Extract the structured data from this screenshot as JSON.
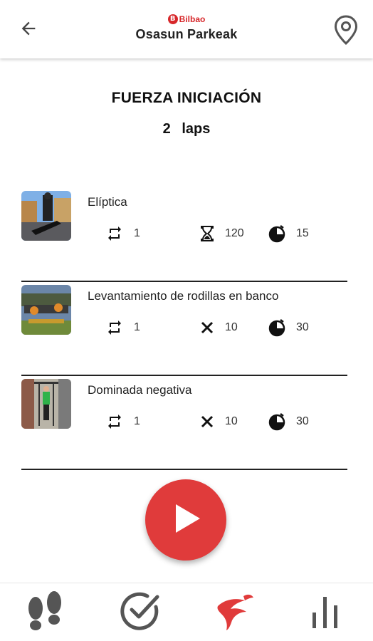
{
  "header": {
    "logo_text": "Bilbao",
    "logo_letter": "B",
    "title": "Osasun Parkeak",
    "back_icon": "arrow-left-icon",
    "location_icon": "location-pin-icon"
  },
  "routine": {
    "title": "FUERZA INICIACIÓN",
    "laps_count": "2",
    "laps_label": "laps"
  },
  "exercises": [
    {
      "name": "Elíptica",
      "stats": [
        {
          "icon": "repeat-icon",
          "value": "1"
        },
        {
          "icon": "hourglass-icon",
          "value": "120"
        },
        {
          "icon": "timer-icon",
          "value": "15"
        }
      ]
    },
    {
      "name": "Levantamiento de rodillas en banco",
      "stats": [
        {
          "icon": "repeat-icon",
          "value": "1"
        },
        {
          "icon": "times-icon",
          "value": "10"
        },
        {
          "icon": "timer-icon",
          "value": "30"
        }
      ]
    },
    {
      "name": "Dominada negativa",
      "stats": [
        {
          "icon": "repeat-icon",
          "value": "1"
        },
        {
          "icon": "times-icon",
          "value": "10"
        },
        {
          "icon": "timer-icon",
          "value": "30"
        }
      ]
    }
  ],
  "play": {
    "icon": "play-icon"
  },
  "bottom_nav": [
    {
      "icon": "footsteps-icon"
    },
    {
      "icon": "check-circle-icon"
    },
    {
      "icon": "runner-logo-icon",
      "active": true
    },
    {
      "icon": "bar-chart-icon"
    }
  ],
  "colors": {
    "accent": "#e03b3b",
    "brand": "#d7272a",
    "text": "#222222",
    "nav_gray": "#555555"
  }
}
